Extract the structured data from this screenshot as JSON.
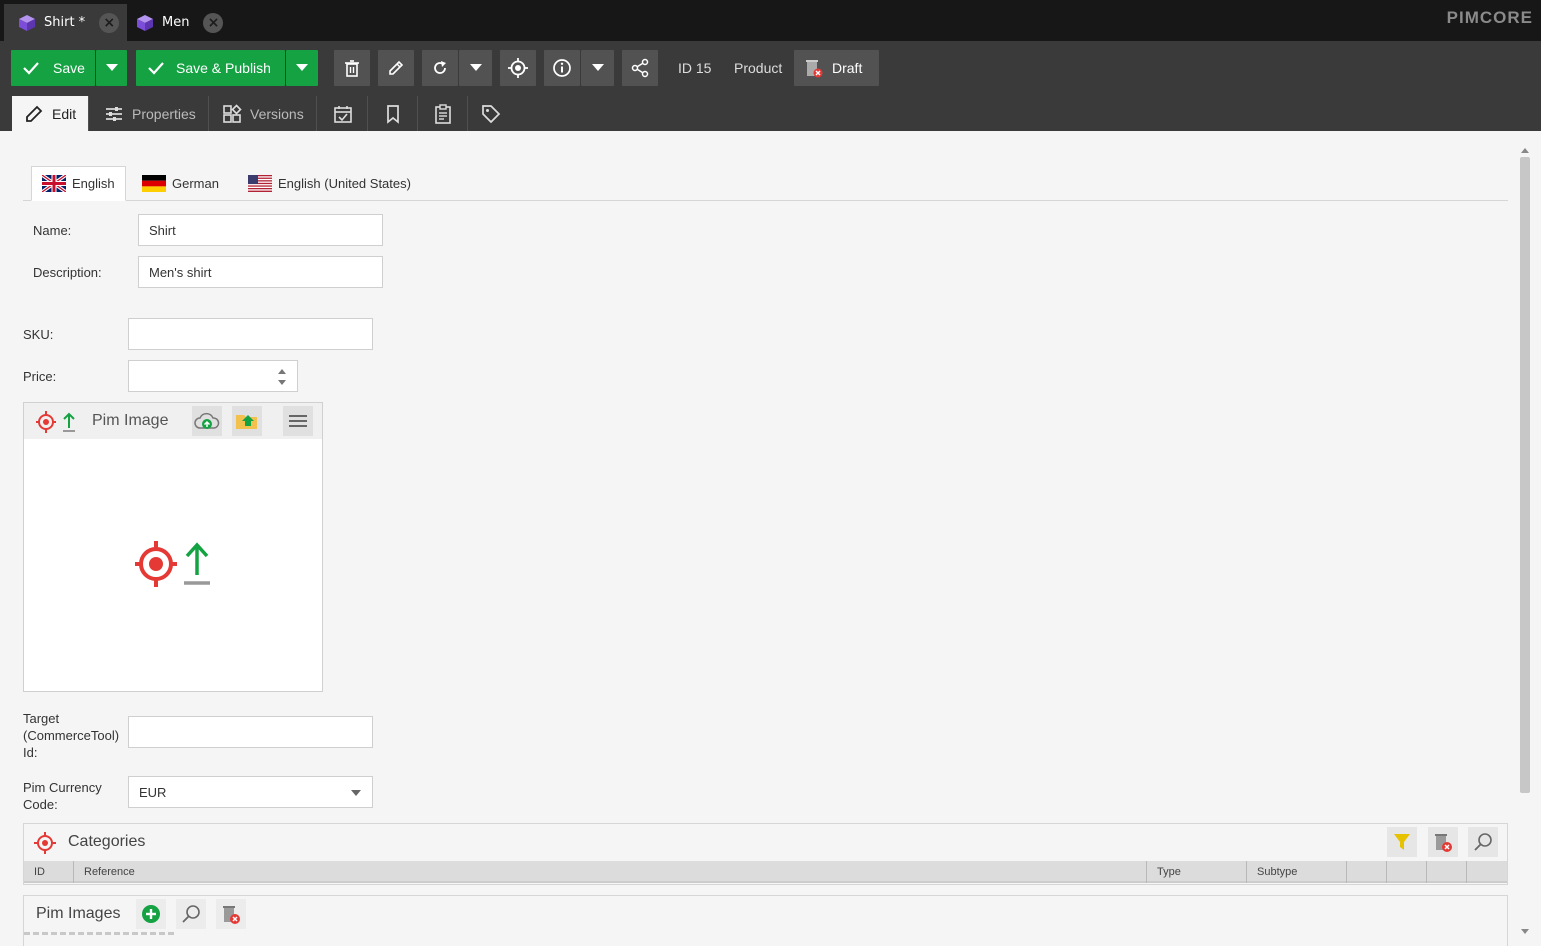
{
  "top_tabs": [
    {
      "label": "Shirt *",
      "icon": "cube-icon"
    },
    {
      "label": "Men",
      "icon": "cube-icon"
    }
  ],
  "brand": "PIMCORE",
  "toolbar": {
    "save_label": "Save",
    "save_publish_label": "Save & Publish",
    "id_text": "ID 15",
    "type_text": "Product",
    "draft_label": "Draft"
  },
  "subtabs": {
    "edit": "Edit",
    "properties": "Properties",
    "versions": "Versions"
  },
  "languages": {
    "english": "English",
    "german": "German",
    "english_us": "English (United States)"
  },
  "fields": {
    "name_label": "Name:",
    "name_value": "Shirt",
    "description_label": "Description:",
    "description_value": "Men's shirt",
    "sku_label": "SKU:",
    "sku_value": "",
    "price_label": "Price:",
    "price_value": "",
    "target_label_1": "Target",
    "target_label_2": "(CommerceTool)",
    "target_label_3": "Id:",
    "target_value": "",
    "currency_label_1": "Pim Currency",
    "currency_label_2": "Code:",
    "currency_value": "EUR"
  },
  "pim_image": {
    "title": "Pim Image"
  },
  "categories": {
    "title": "Categories",
    "columns": {
      "id": "ID",
      "reference": "Reference",
      "type": "Type",
      "subtype": "Subtype"
    }
  },
  "pim_images": {
    "title": "Pim Images"
  },
  "colors": {
    "accent_green": "#14a243",
    "target_red": "#e53935",
    "topbar": "#171717",
    "toolbar": "#3a3a3a"
  }
}
